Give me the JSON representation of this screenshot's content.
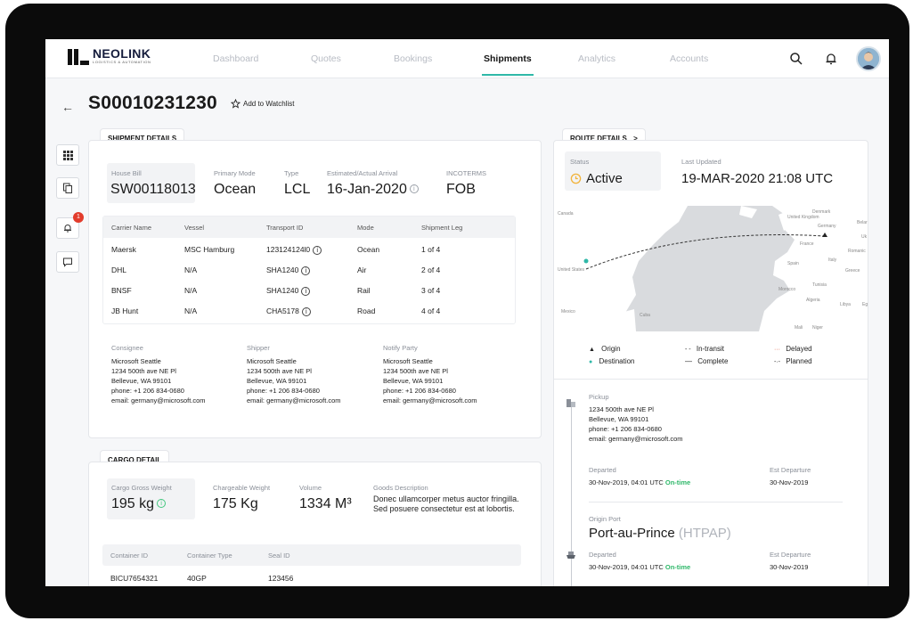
{
  "app": {
    "logo_name": "NEOLINK",
    "logo_tagline": "LOGISTICS & AUTOMATION"
  },
  "nav": {
    "items": [
      {
        "label": "Dashboard"
      },
      {
        "label": "Quotes"
      },
      {
        "label": "Bookings"
      },
      {
        "label": "Shipments",
        "active": true
      },
      {
        "label": "Analytics"
      },
      {
        "label": "Accounts"
      }
    ]
  },
  "header_icons": [
    "search-icon",
    "bell-icon",
    "avatar"
  ],
  "page": {
    "back": "←",
    "title": "S00010231230",
    "watchlist": "Add to Watchlist"
  },
  "side_tools": {
    "items": [
      "grid-icon",
      "copy-icon",
      "bell-icon",
      "message-icon"
    ],
    "notification_count": "1"
  },
  "shipment": {
    "tab_label": "SHIPMENT DETAILS",
    "house_bill_label": "House Bill",
    "house_bill": "SW00118013",
    "primary_mode_label": "Primary Mode",
    "primary_mode": "Ocean",
    "type_label": "Type",
    "type": "LCL",
    "arrival_label": "Estimated/Actual Arrival",
    "arrival": "16-Jan-2020",
    "incoterms_label": "INCOTERMS",
    "incoterms": "FOB",
    "table": {
      "headers": [
        "Carrier Name",
        "Vessel",
        "Transport ID",
        "Mode",
        "Shipment Leg"
      ],
      "rows": [
        [
          "Maersk",
          "MSC Hamburg",
          "123124124l0",
          "Ocean",
          "1 of 4"
        ],
        [
          "DHL",
          "N/A",
          "SHA1240",
          "Air",
          "2 of 4"
        ],
        [
          "BNSF",
          "N/A",
          "SHA1240",
          "Rail",
          "3 of 4"
        ],
        [
          "JB Hunt",
          "N/A",
          "CHA5178",
          "Road",
          "4 of 4"
        ]
      ]
    },
    "parties": [
      {
        "label": "Consignee",
        "text": "Microsoft Seattle\n1234 500th ave NE Pl\nBellevue, WA 99101\nphone: +1 206 834-0680\nemail: germany@microsoft.com"
      },
      {
        "label": "Shipper",
        "text": "Microsoft Seattle\n1234 500th ave NE Pl\nBellevue, WA 99101\nphone: +1 206 834-0680\nemail: germany@microsoft.com"
      },
      {
        "label": "Notify Party",
        "text": "Microsoft Seattle\n1234 500th ave NE Pl\nBellevue, WA 99101\nphone: +1 206 834-0680\nemail: germany@microsoft.com"
      }
    ]
  },
  "cargo": {
    "tab_label": "CARGO DETAIL",
    "gross_weight_label": "Cargo Gross Weight",
    "gross_weight": "195 kg",
    "chargeable_label": "Chargeable Weight",
    "chargeable": "175 Kg",
    "volume_label": "Volume",
    "volume": "1334 M³",
    "goods_label": "Goods Description",
    "goods": "Donec ullamcorper metus auctor fringilla. Sed posuere consectetur est at lobortis.",
    "table": {
      "headers": [
        "Container ID",
        "Container Type",
        "Seal ID"
      ],
      "rows": [
        [
          "BICU7654321",
          "40GP",
          "123456"
        ]
      ]
    }
  },
  "route": {
    "tab_label": "ROUTE DETAILS",
    "tab_chevron": ">",
    "status_label": "Status",
    "status": "Active",
    "updated_label": "Last Updated",
    "updated": "19-MAR-2020 21:08 UTC",
    "map_labels": {
      "canada": "Canada",
      "united_states": "United States",
      "mexico": "Mexico",
      "cuba": "Cuba",
      "united_kingdom": "United Kingdom",
      "denmark": "Denmark",
      "belarus": "Belar",
      "germany": "Germany",
      "uk": "Uk",
      "france": "France",
      "romania": "Romanic",
      "spain": "Spain",
      "italy": "Italy",
      "greece": "Greece",
      "tunisia": "Tunisia",
      "morocco": "Morocco",
      "algeria": "Algeria",
      "libya": "Libya",
      "egypt": "Eg",
      "mali": "Mali",
      "niger": "Niger"
    },
    "legend": [
      {
        "symbol": "▲",
        "label": "Origin"
      },
      {
        "symbol": "- -",
        "label": "In-transit"
      },
      {
        "symbol": "···",
        "label": "Delayed"
      },
      {
        "symbol": "●",
        "label": "Destination"
      },
      {
        "symbol": "—",
        "label": "Complete"
      },
      {
        "symbol": "-·-",
        "label": "Planned"
      }
    ],
    "pickup": {
      "label": "Pickup",
      "address": "1234 500th ave NE Pl\nBellevue, WA 99101\nphone: +1 206 834-0680\nemail: germany@microsoft.com",
      "departed_label": "Departed",
      "departed": "30-Nov-2019, 04:01 UTC",
      "ontime": "On-time",
      "est_label": "Est Departure",
      "est": "30-Nov-2019"
    },
    "origin_port": {
      "label": "Origin Port",
      "name": "Port-au-Prince",
      "code": "(HTPAP)",
      "departed_label": "Departed",
      "departed": "30-Nov-2019, 04:01 UTC",
      "ontime": "On-time",
      "est_label": "Est Departure",
      "est": "30-Nov-2019"
    }
  },
  "colors": {
    "accent": "#2fb8a8",
    "active_status": "#f2b33a",
    "ontime": "#2fb86a",
    "delayed": "#e2593c",
    "badge": "#e23c2c"
  }
}
